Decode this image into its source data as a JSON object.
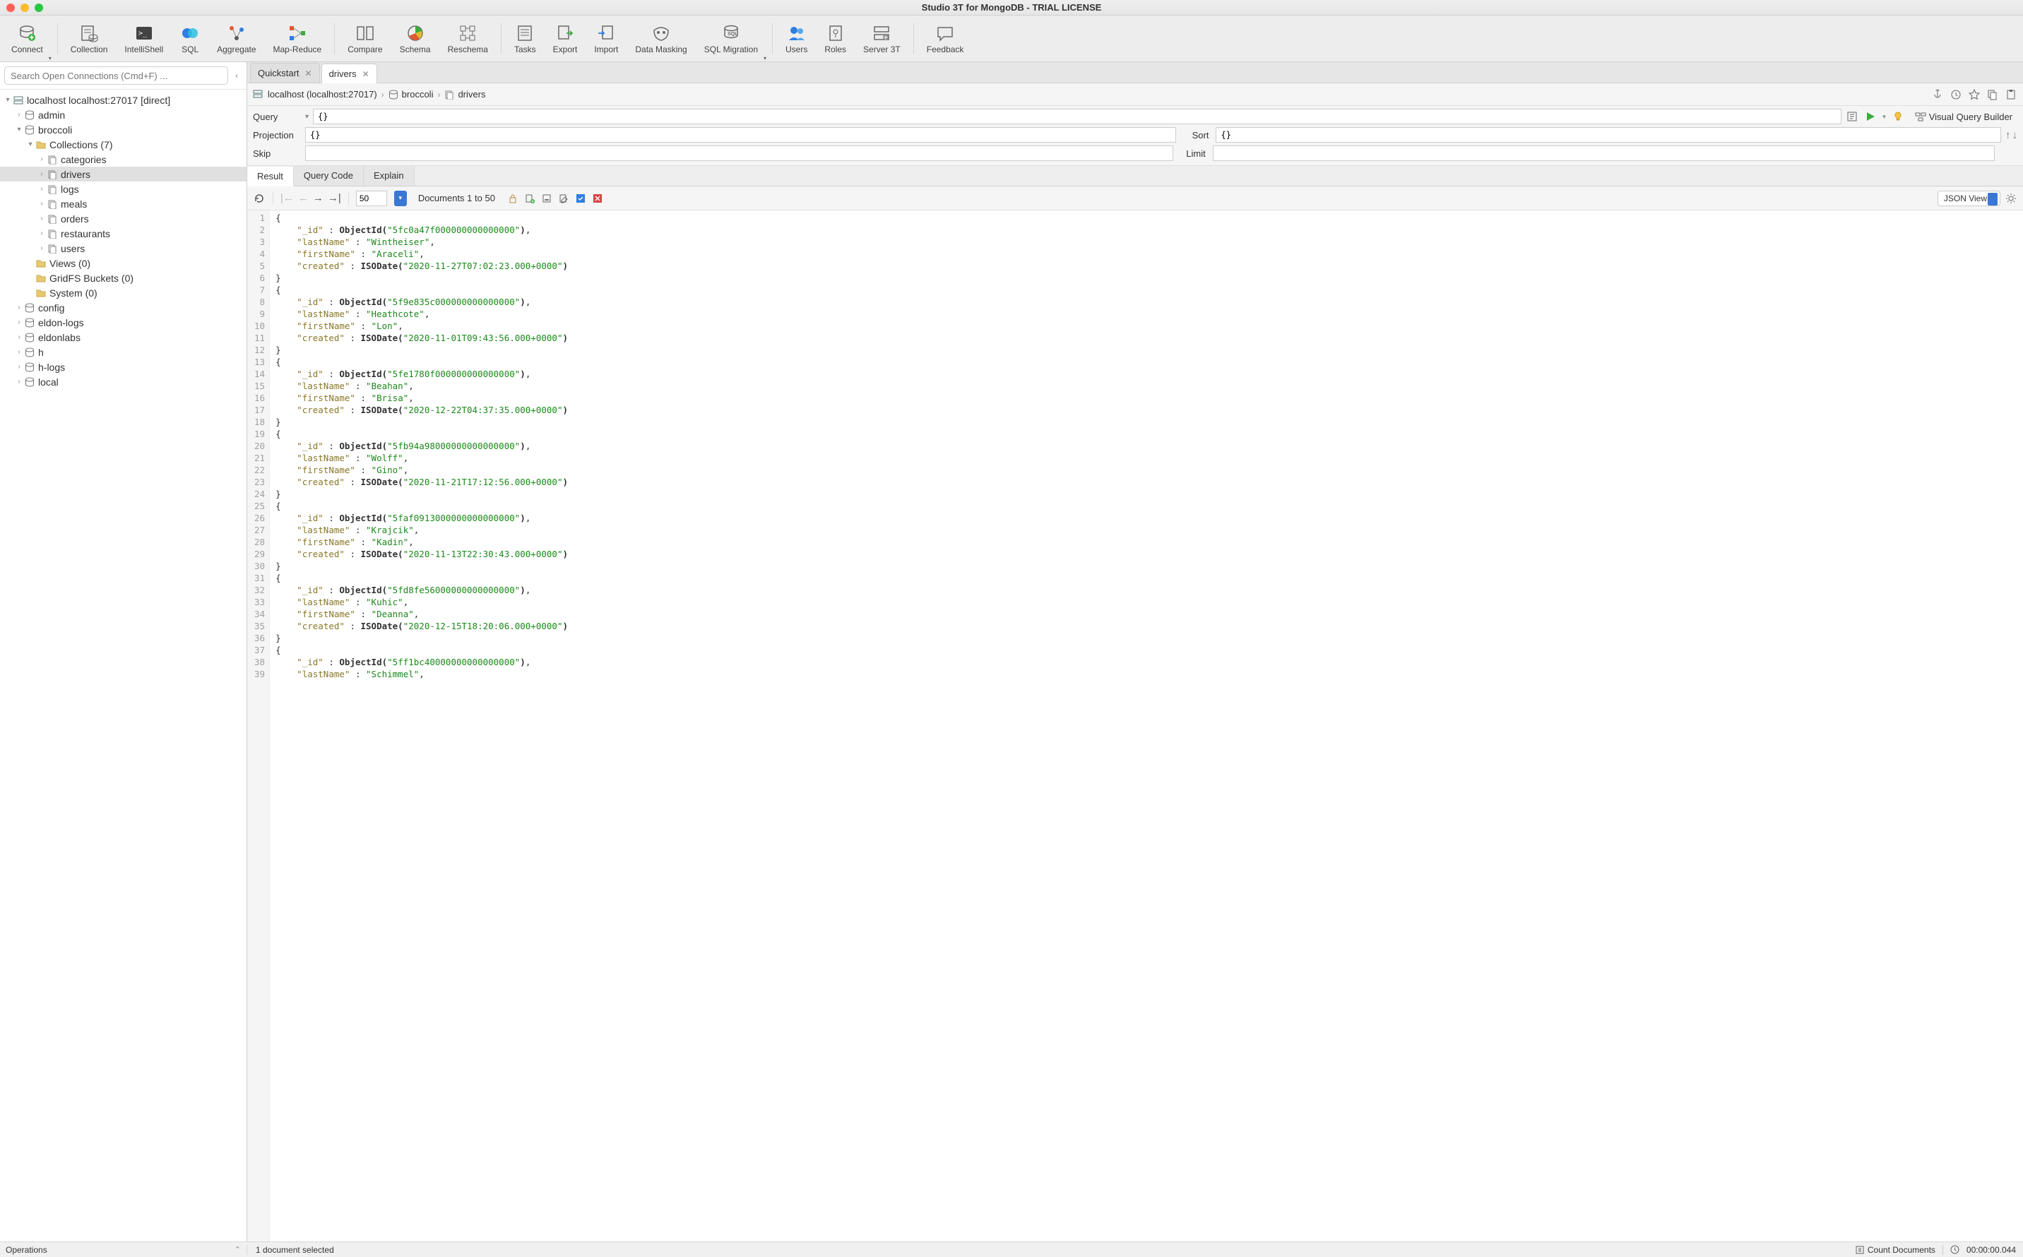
{
  "window_title": "Studio 3T for MongoDB - TRIAL LICENSE",
  "search_placeholder": "Search Open Connections (Cmd+F) ...",
  "toolbar": [
    {
      "label": "Connect"
    },
    {
      "label": "Collection"
    },
    {
      "label": "IntelliShell"
    },
    {
      "label": "SQL"
    },
    {
      "label": "Aggregate"
    },
    {
      "label": "Map-Reduce"
    },
    {
      "label": "Compare"
    },
    {
      "label": "Schema"
    },
    {
      "label": "Reschema"
    },
    {
      "label": "Tasks"
    },
    {
      "label": "Export"
    },
    {
      "label": "Import"
    },
    {
      "label": "Data Masking"
    },
    {
      "label": "SQL Migration"
    },
    {
      "label": "Users"
    },
    {
      "label": "Roles"
    },
    {
      "label": "Server 3T"
    },
    {
      "label": "Feedback"
    }
  ],
  "tree": {
    "conn": "localhost localhost:27017 [direct]",
    "dbs": [
      "admin",
      "broccoli",
      "config",
      "eldon-logs",
      "eldonlabs",
      "h",
      "h-logs",
      "local"
    ],
    "broccoli": {
      "collections_label": "Collections (7)",
      "collections": [
        "categories",
        "drivers",
        "logs",
        "meals",
        "orders",
        "restaurants",
        "users"
      ],
      "views": "Views (0)",
      "gridfs": "GridFS Buckets (0)",
      "system": "System (0)"
    }
  },
  "tabs": [
    {
      "label": "Quickstart",
      "active": false
    },
    {
      "label": "drivers",
      "active": true
    }
  ],
  "breadcrumb": {
    "conn": "localhost (localhost:27017)",
    "db": "broccoli",
    "coll": "drivers"
  },
  "query": {
    "query_label": "Query",
    "query_value": "{}",
    "projection_label": "Projection",
    "projection_value": "{}",
    "sort_label": "Sort",
    "sort_value": "{}",
    "skip_label": "Skip",
    "skip_value": "",
    "limit_label": "Limit",
    "limit_value": "",
    "vqb": "Visual Query Builder"
  },
  "result_tabs": [
    "Result",
    "Query Code",
    "Explain"
  ],
  "result_toolbar": {
    "page_size": "50",
    "doc_range": "Documents 1 to 50",
    "view_mode": "JSON View"
  },
  "documents": [
    {
      "_id": "5fc0a47f000000000000000",
      "lastName": "Wintheiser",
      "firstName": "Araceli",
      "created": "2020-11-27T07:02:23.000+0000"
    },
    {
      "_id": "5f9e835c000000000000000",
      "lastName": "Heathcote",
      "firstName": "Lon",
      "created": "2020-11-01T09:43:56.000+0000"
    },
    {
      "_id": "5fe1780f000000000000000",
      "lastName": "Beahan",
      "firstName": "Brisa",
      "created": "2020-12-22T04:37:35.000+0000"
    },
    {
      "_id": "5fb94a98000000000000000",
      "lastName": "Wolff",
      "firstName": "Gino",
      "created": "2020-11-21T17:12:56.000+0000"
    },
    {
      "_id": "5faf0913000000000000000",
      "lastName": "Krajcik",
      "firstName": "Kadin",
      "created": "2020-11-13T22:30:43.000+0000"
    },
    {
      "_id": "5fd8fe56000000000000000",
      "lastName": "Kuhic",
      "firstName": "Deanna",
      "created": "2020-12-15T18:20:06.000+0000"
    },
    {
      "_id": "5ff1bc40000000000000000",
      "lastName": "Schimmel"
    }
  ],
  "status": {
    "operations": "Operations",
    "selected": "1 document selected",
    "count_docs": "Count Documents",
    "elapsed": "00:00:00.044"
  }
}
